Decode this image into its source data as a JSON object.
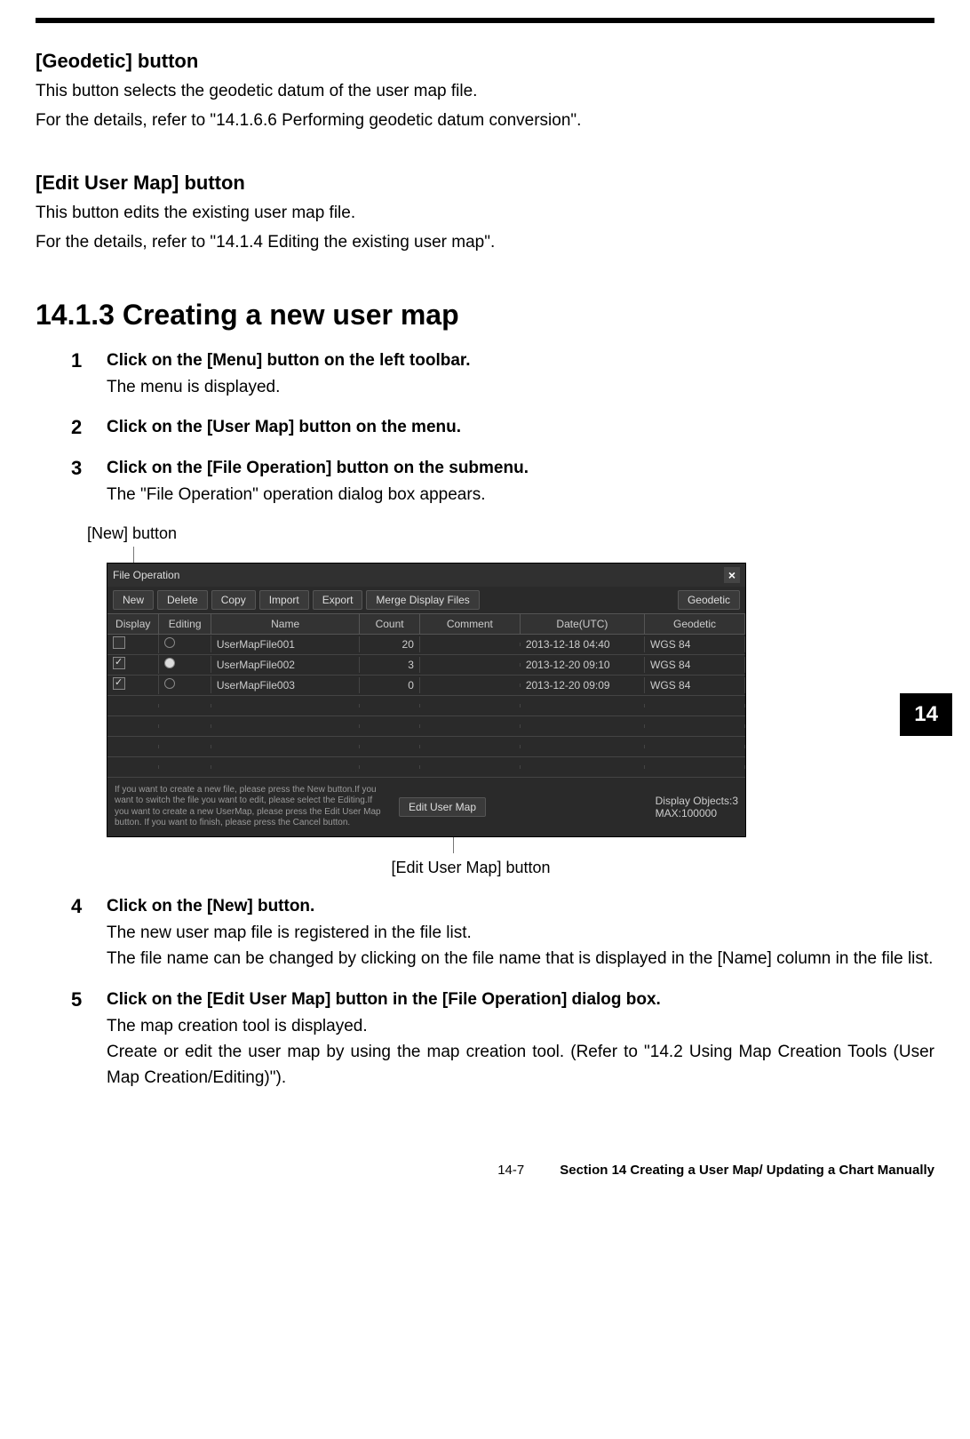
{
  "geodetic": {
    "title": "[Geodetic] button",
    "p1": "This button selects the geodetic datum of the user map file.",
    "p2": "For the details, refer to \"14.1.6.6 Performing geodetic datum conversion\"."
  },
  "editmap": {
    "title": "[Edit User Map] button",
    "p1": "This button edits the existing user map file.",
    "p2": "For the details, refer to \"14.1.4 Editing the existing user map\"."
  },
  "section": {
    "heading": "14.1.3   Creating a new user map"
  },
  "steps": [
    {
      "num": "1",
      "inst": "Click on the [Menu] button on the left toolbar.",
      "desc": "The menu is displayed."
    },
    {
      "num": "2",
      "inst": "Click on the [User Map] button on the menu.",
      "desc": ""
    },
    {
      "num": "3",
      "inst": "Click on the [File Operation] button on the submenu.",
      "desc": "The \"File Operation\" operation dialog box appears."
    },
    {
      "num": "4",
      "inst": "Click on the [New] button.",
      "desc": "The new user map file is registered in the file list.\nThe file name can be changed by clicking on the file name that is displayed in the [Name] column in the file list."
    },
    {
      "num": "5",
      "inst": "Click on the [Edit User Map] button in the [File Operation] dialog box.",
      "desc": "The map creation tool is displayed.\nCreate or edit the user map by using the map creation tool. (Refer to \"14.2 Using Map Creation Tools (User Map Creation/Editing)\")."
    }
  ],
  "callouts": {
    "new": "[New] button",
    "edit": "[Edit User Map] button"
  },
  "dialog": {
    "title": "File Operation",
    "toolbar": {
      "new": "New",
      "delete": "Delete",
      "copy": "Copy",
      "import": "Import",
      "export": "Export",
      "merge": "Merge Display Files",
      "geodetic": "Geodetic"
    },
    "headers": {
      "display": "Display",
      "editing": "Editing",
      "name": "Name",
      "count": "Count",
      "comment": "Comment",
      "date": "Date(UTC)",
      "geodetic": "Geodetic"
    },
    "rows": [
      {
        "display": false,
        "editing": false,
        "name": "UserMapFile001",
        "count": "20",
        "comment": "",
        "date": "2013-12-18 04:40",
        "geo": "WGS 84"
      },
      {
        "display": true,
        "editing": true,
        "name": "UserMapFile002",
        "count": "3",
        "comment": "",
        "date": "2013-12-20 09:10",
        "geo": "WGS 84"
      },
      {
        "display": true,
        "editing": false,
        "name": "UserMapFile003",
        "count": "0",
        "comment": "",
        "date": "2013-12-20 09:09",
        "geo": "WGS 84"
      }
    ],
    "hint": "If you want to create a new file, please press the New button.If you want to switch the file you want to edit, please select the Editing.If you want to create a new UserMap, please press the Edit User Map button. If you want to finish, please press the Cancel button.",
    "edit_btn": "Edit User Map",
    "info1": "Display Objects:3",
    "info2": "MAX:100000"
  },
  "sideTab": "14",
  "footer": {
    "page": "14-7",
    "section": "Section 14    Creating a User Map/ Updating a Chart Manually"
  }
}
